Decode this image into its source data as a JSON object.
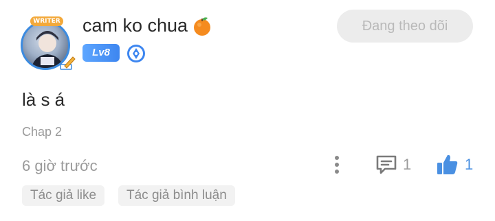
{
  "user": {
    "name": "cam ko chua",
    "level": "Lv8",
    "avatar_badge": "WRITER"
  },
  "follow_button": {
    "label": "Đang theo dõi"
  },
  "comment": {
    "text": "là s á",
    "chapter": "Chap 2",
    "timestamp": "6 giờ trước",
    "reply_count": "1",
    "like_count": "1"
  },
  "tags": [
    "Tác giả like",
    "Tác giả bình luận"
  ],
  "colors": {
    "accent": "#4a90e2",
    "muted_text": "#9a9a9a",
    "follow_bg": "#ececec",
    "level_badge": "#3d86f0"
  },
  "icons": {
    "emoji": "orange-icon",
    "rank": "rank-icon",
    "more": "more-vertical-icon",
    "reply": "comment-icon",
    "like": "thumbs-up-icon"
  }
}
